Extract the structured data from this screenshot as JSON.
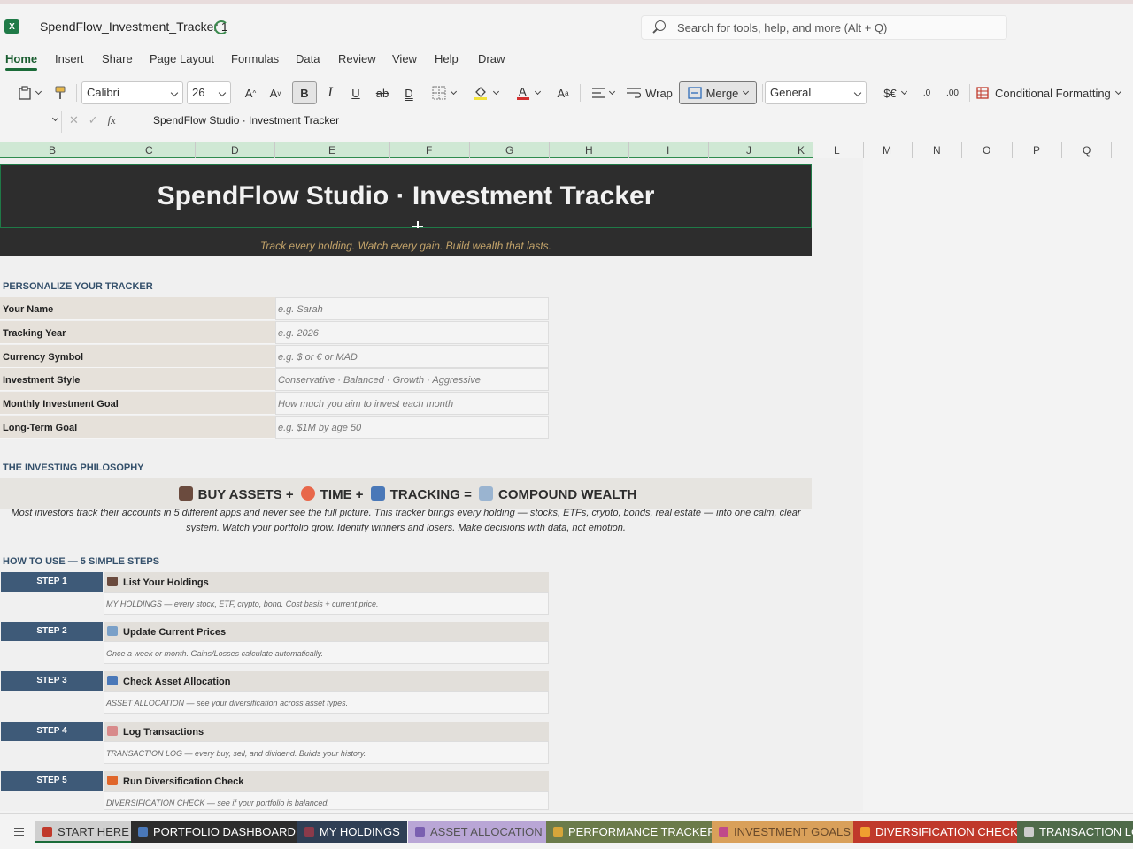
{
  "window": {
    "doc_title": "SpendFlow_Investment_Tracker 1",
    "search_placeholder": "Search for tools, help, and more (Alt + Q)"
  },
  "ribbon_tabs": [
    "Home",
    "Insert",
    "Share",
    "Page Layout",
    "Formulas",
    "Data",
    "Review",
    "View",
    "Help",
    "Draw"
  ],
  "toolbar": {
    "font_name": "Calibri",
    "font_size": "26",
    "wrap_label": "Wrap",
    "merge_label": "Merge",
    "number_format": "General",
    "currency_label": "$€",
    "cond_format_label": "Conditional Formatting"
  },
  "formula_bar": {
    "content": "SpendFlow Studio · Investment Tracker"
  },
  "columns": [
    "B",
    "C",
    "D",
    "E",
    "F",
    "G",
    "H",
    "I",
    "J",
    "K",
    "L",
    "M",
    "N",
    "O",
    "P",
    "Q"
  ],
  "sheet": {
    "title": "SpendFlow Studio  ·  Investment Tracker",
    "tagline": "Track every holding. Watch every gain. Build wealth that lasts.",
    "personalize_heading": "PERSONALIZE YOUR TRACKER",
    "personalize_rows": [
      {
        "label": "Your Name",
        "placeholder": "e.g. Sarah"
      },
      {
        "label": "Tracking Year",
        "placeholder": "e.g. 2026"
      },
      {
        "label": "Currency Symbol",
        "placeholder": "e.g. $ or € or MAD"
      },
      {
        "label": "Investment Style",
        "placeholder": "Conservative · Balanced · Growth · Aggressive"
      },
      {
        "label": "Monthly Investment Goal",
        "placeholder": "How much you aim to invest each month"
      },
      {
        "label": "Long-Term Goal",
        "placeholder": "e.g. $1M by age 50"
      }
    ],
    "philosophy_heading": "THE INVESTING PHILOSOPHY",
    "philosophy": {
      "buy_assets": "BUY ASSETS",
      "plus1": "+",
      "time": "TIME",
      "plus2": "+",
      "tracking": "TRACKING",
      "equals": "=",
      "compound": "COMPOUND WEALTH",
      "desc_line1": "Most investors track their accounts in 5 different apps and never see the full picture. This tracker brings every holding — stocks, ETFs, crypto, bonds, real estate — into one calm, clear",
      "desc_line2": "system. Watch your portfolio grow. Identify winners and losers. Make decisions with data, not emotion."
    },
    "steps_heading": "HOW TO USE — 5 SIMPLE STEPS",
    "steps": [
      {
        "badge": "STEP 1",
        "title": "List Your Holdings",
        "desc": "MY HOLDINGS — every stock, ETF, crypto, bond. Cost basis + current price.",
        "icon_color": "#6b4b3e"
      },
      {
        "badge": "STEP 2",
        "title": "Update Current Prices",
        "desc": "Once a week or month. Gains/Losses calculate automatically.",
        "icon_color": "#7aa0c8"
      },
      {
        "badge": "STEP 3",
        "title": "Check Asset Allocation",
        "desc": "ASSET ALLOCATION — see your diversification across asset types.",
        "icon_color": "#4a78b8"
      },
      {
        "badge": "STEP 4",
        "title": "Log Transactions",
        "desc": "TRANSACTION LOG — every buy, sell, and dividend. Builds your history.",
        "icon_color": "#d88a8a"
      },
      {
        "badge": "STEP 5",
        "title": "Run Diversification Check",
        "desc": "DIVERSIFICATION CHECK — see if your portfolio is balanced.",
        "icon_color": "#e0662a"
      }
    ]
  },
  "sheet_tabs": [
    {
      "label": "START HERE",
      "bg": "#cfcfcf",
      "fg": "#333333",
      "icon": "#c0392b"
    },
    {
      "label": "PORTFOLIO DASHBOARD",
      "bg": "#2d2d2d",
      "fg": "#ffffff",
      "icon": "#4a78b8"
    },
    {
      "label": "MY HOLDINGS",
      "bg": "#2f3f55",
      "fg": "#ffffff",
      "icon": "#8b3a4a"
    },
    {
      "label": "ASSET ALLOCATION",
      "bg": "#b9a6d6",
      "fg": "#555555",
      "icon": "#7a5fb0"
    },
    {
      "label": "PERFORMANCE TRACKER",
      "bg": "#6b7b4a",
      "fg": "#ffffff",
      "icon": "#d6a53a"
    },
    {
      "label": "INVESTMENT GOALS",
      "bg": "#d9a05a",
      "fg": "#6a4a2a",
      "icon": "#c04a8a"
    },
    {
      "label": "DIVERSIFICATION CHECK",
      "bg": "#c0392b",
      "fg": "#ffffff",
      "icon": "#f0a030"
    },
    {
      "label": "TRANSACTION LO",
      "bg": "#4f6b4a",
      "fg": "#ffffff",
      "icon": "#cccccc"
    }
  ]
}
